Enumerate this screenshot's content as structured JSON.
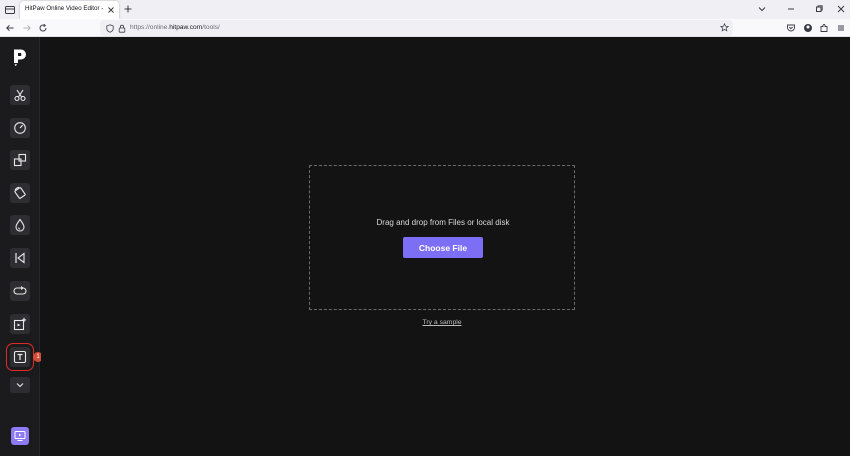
{
  "browser": {
    "tab_title": "HitPaw Online Video Editor - All-in",
    "url_prefix": "https://online.",
    "url_host": "hitpaw.com",
    "url_suffix": "/tools/"
  },
  "sidebar": {
    "tools": [
      {
        "icon": "scissors-icon"
      },
      {
        "icon": "speed-icon"
      },
      {
        "icon": "resize-icon"
      },
      {
        "icon": "rotate-icon"
      },
      {
        "icon": "watermark-icon"
      },
      {
        "icon": "reverse-icon"
      },
      {
        "icon": "loop-icon"
      },
      {
        "icon": "add-media-icon"
      },
      {
        "icon": "text-icon"
      }
    ],
    "badge": "1",
    "accent": "#8e7af5",
    "highlight_color": "#e02b2b"
  },
  "main": {
    "drop_text": "Drag and drop from Files or local disk",
    "choose_button": "Choose File",
    "sample_link": "Try a sample",
    "button_color": "#7c6ff5"
  }
}
